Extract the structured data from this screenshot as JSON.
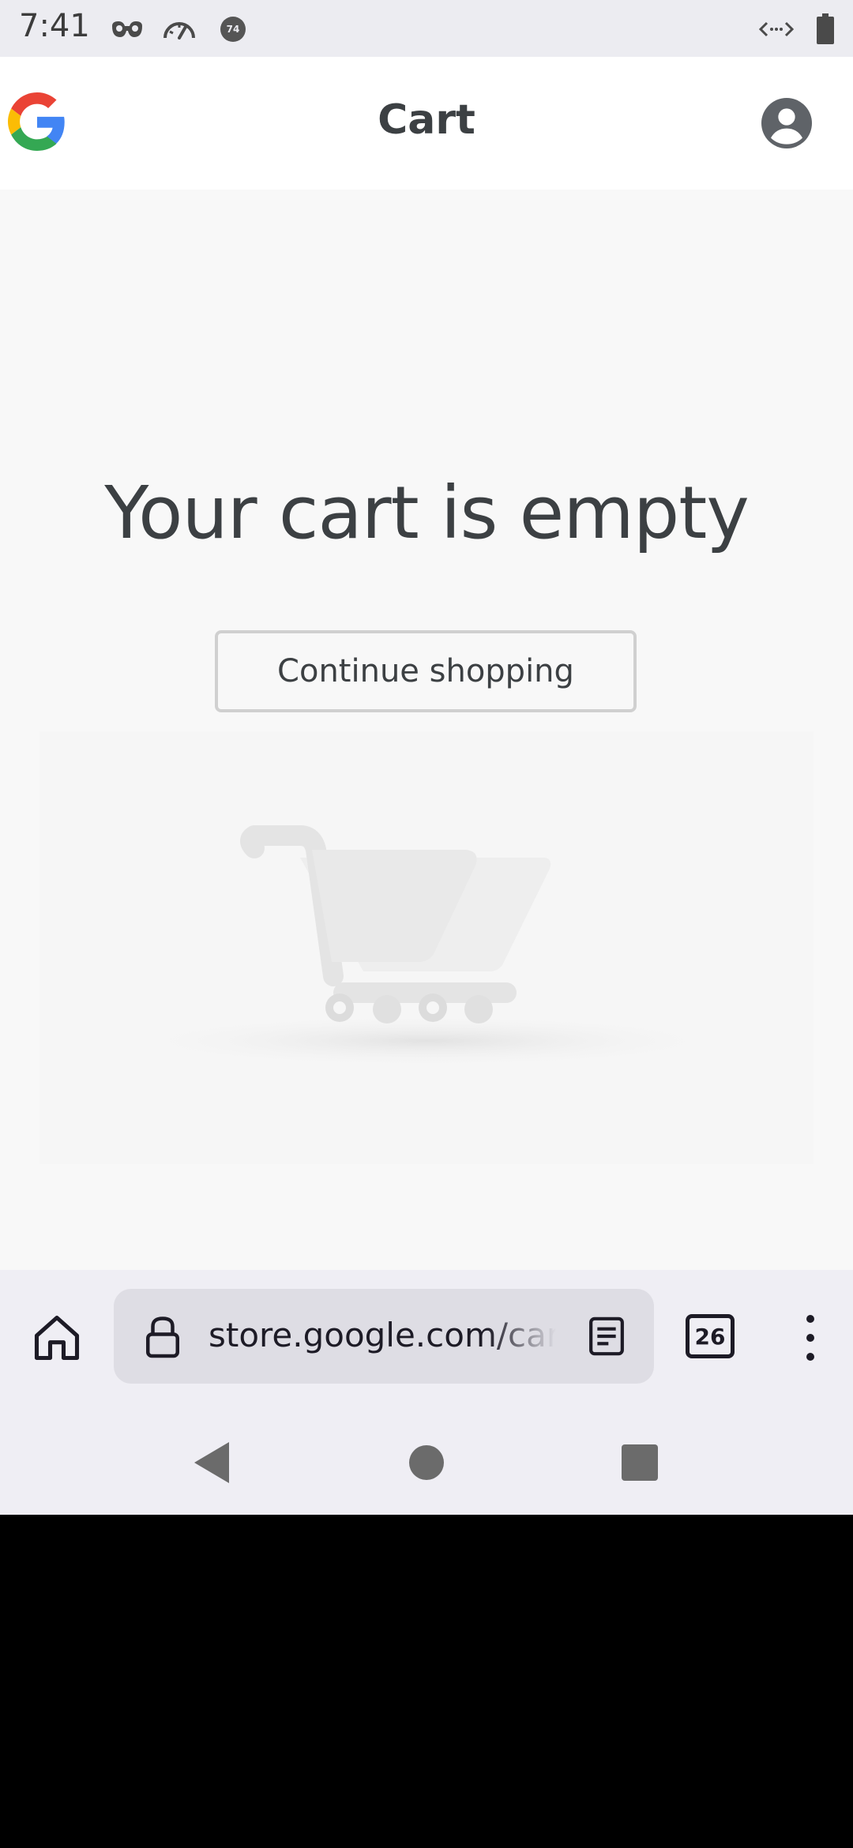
{
  "status_bar": {
    "time": "7:41",
    "icons_left": [
      "incognito-mask-icon",
      "speedometer-icon",
      "data-saver-74-icon"
    ],
    "badge_text": "74",
    "icons_right": [
      "code-brackets-icon",
      "battery-icon"
    ]
  },
  "header": {
    "logo": "google-g-logo",
    "title": "Cart",
    "account_icon": "account-circle-icon"
  },
  "main": {
    "empty_message": "Your cart is empty",
    "continue_button_label": "Continue shopping",
    "illustration": "shopping-cart-illustration"
  },
  "browser": {
    "home_icon": "home-icon",
    "lock_icon": "lock-icon",
    "url": "store.google.com/cart",
    "reader_icon": "reader-mode-icon",
    "tab_count": "26",
    "menu_icon": "more-vert-icon"
  },
  "navigation": {
    "buttons": [
      "back-icon",
      "home-circle-icon",
      "recents-square-icon"
    ]
  },
  "colors": {
    "page_background": "#f8f8f8",
    "header_background": "#ffffff",
    "text_primary": "#3c4043",
    "browser_bar": "#efeef4",
    "url_box": "#dedde4",
    "button_border": "#d0d0d0"
  }
}
